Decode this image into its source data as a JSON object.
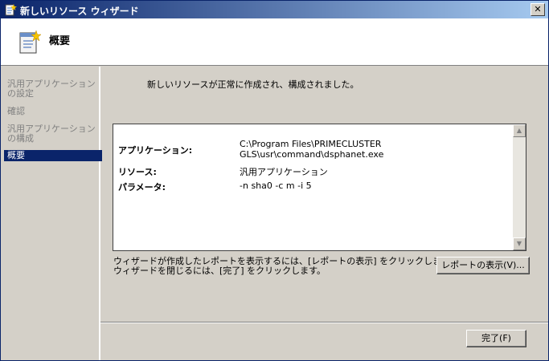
{
  "window": {
    "title": "新しいリソース ウィザード",
    "close_glyph": "✕"
  },
  "header": {
    "title": "概要"
  },
  "sidebar": {
    "items": [
      {
        "label": "汎用アプリケーションの設定",
        "active": false
      },
      {
        "label": "確認",
        "active": false
      },
      {
        "label": "汎用アプリケーション の構成",
        "active": false
      },
      {
        "label": "概要",
        "active": true
      }
    ]
  },
  "main": {
    "message": "新しいリソースが正常に作成され、構成されました。",
    "report": {
      "rows": [
        {
          "label": "アプリケーション:",
          "value_line1": "C:\\Program Files\\PRIMECLUSTER",
          "value_line2": "GLS\\usr\\command\\dsphanet.exe"
        },
        {
          "label": "リソース:",
          "value": "汎用アプリケーション"
        },
        {
          "label": "パラメータ:",
          "value": "-n sha0 -c m -i 5"
        }
      ]
    },
    "note_line1": "ウィザードが作成したレポートを表示するには、[レポートの表示] をクリックします。",
    "note_line2": "ウィザードを閉じるには、[完了] をクリックします。",
    "view_report_button": "レポートの表示(V)...",
    "finish_button": "完了(F)"
  },
  "colors": {
    "titlebar_start": "#0a246a",
    "titlebar_end": "#a6caf0",
    "face": "#d4d0c8",
    "active_item": "#0a246a"
  }
}
